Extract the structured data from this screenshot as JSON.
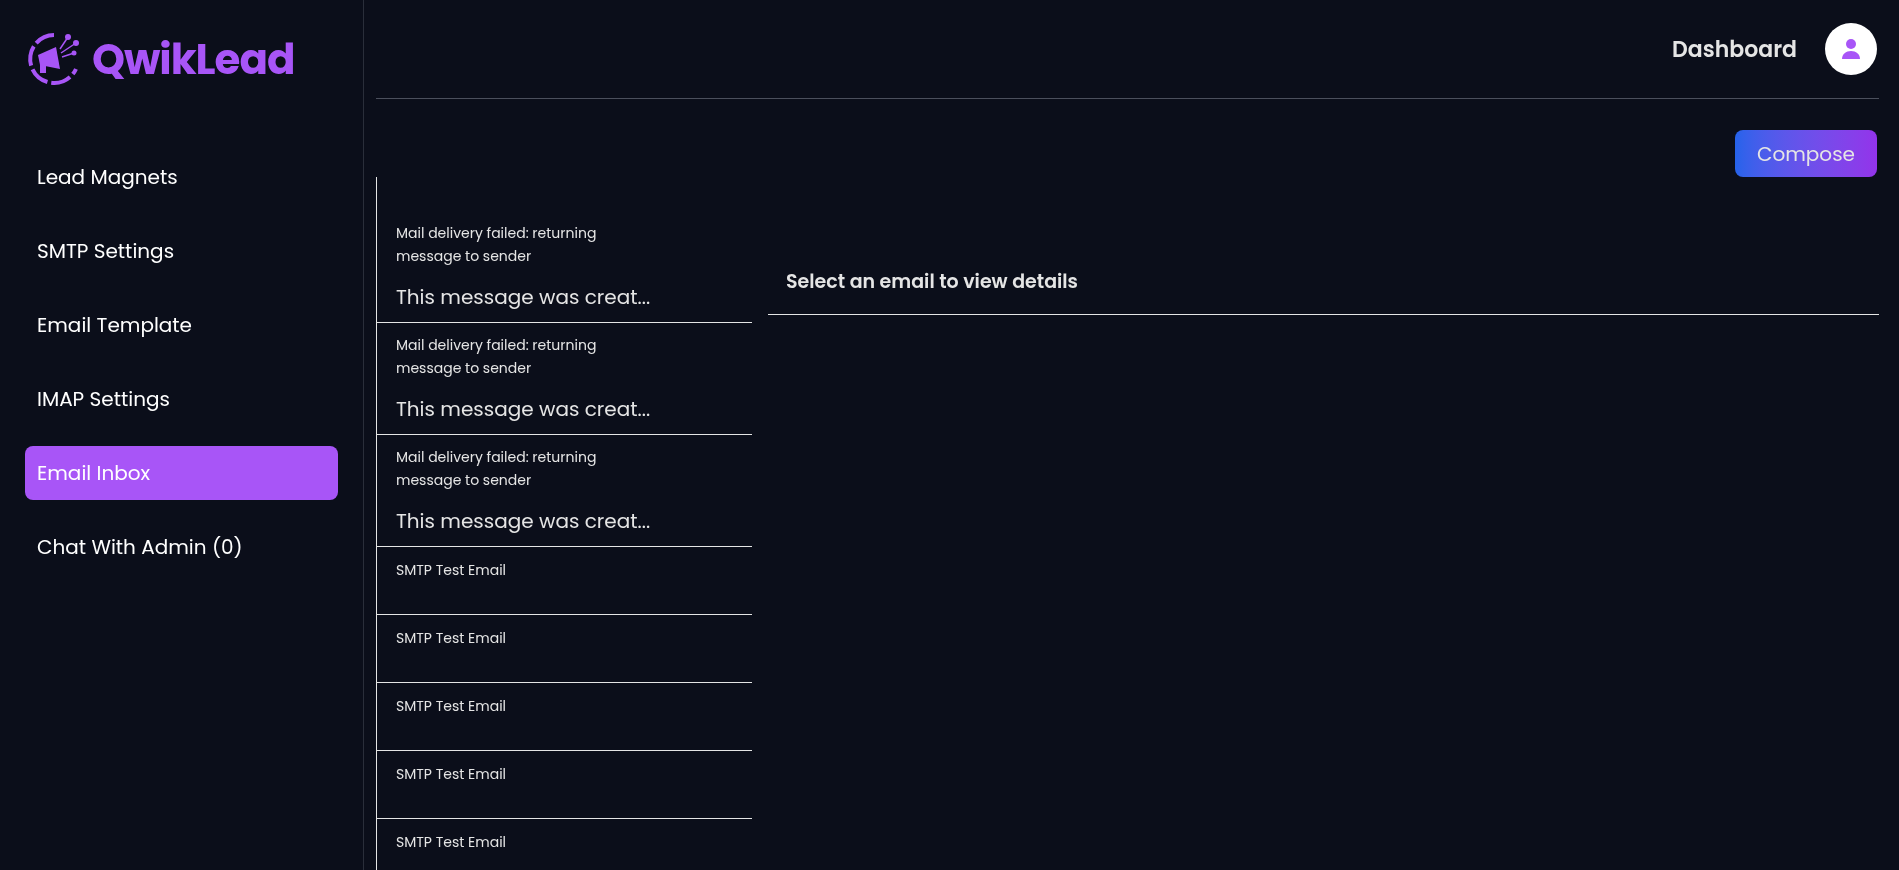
{
  "brand": {
    "name": "QwikLead"
  },
  "sidebar": {
    "items": [
      {
        "label": "Lead Magnets",
        "selected": false
      },
      {
        "label": "SMTP Settings",
        "selected": false
      },
      {
        "label": "Email Template",
        "selected": false
      },
      {
        "label": "IMAP Settings",
        "selected": false
      },
      {
        "label": "Email Inbox",
        "selected": true
      },
      {
        "label": "Chat With Admin (0)",
        "selected": false
      }
    ]
  },
  "header": {
    "title": "Dashboard"
  },
  "compose_button": "Compose",
  "emails": [
    {
      "subject": "Mail delivery failed: returning message to sender",
      "preview": "This message was creat..."
    },
    {
      "subject": "Mail delivery failed: returning message to sender",
      "preview": "This message was creat..."
    },
    {
      "subject": "Mail delivery failed: returning message to sender",
      "preview": "This message was creat..."
    },
    {
      "subject": "SMTP Test Email"
    },
    {
      "subject": "SMTP Test Email"
    },
    {
      "subject": "SMTP Test Email"
    },
    {
      "subject": "SMTP Test Email"
    },
    {
      "subject": "SMTP Test Email"
    }
  ],
  "detail": {
    "placeholder_text": "Select an email to view details"
  }
}
